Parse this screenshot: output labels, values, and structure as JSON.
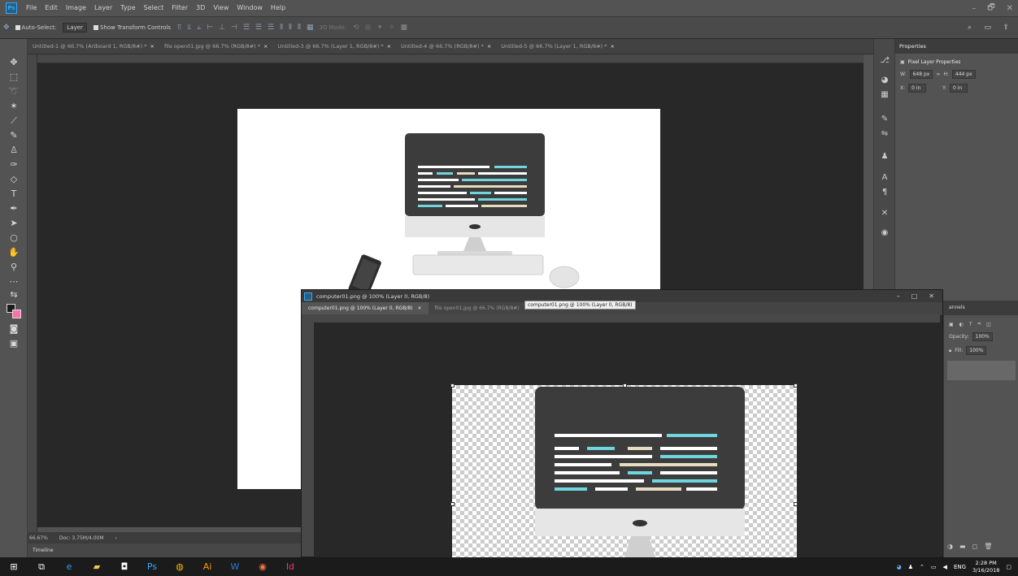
{
  "menubar": {
    "logo": "Ps",
    "items": [
      "File",
      "Edit",
      "Image",
      "Layer",
      "Type",
      "Select",
      "Filter",
      "3D",
      "View",
      "Window",
      "Help"
    ],
    "window_controls": [
      "–",
      "🗗",
      "✕"
    ]
  },
  "options": {
    "auto_select": "Auto-Select:",
    "auto_select_target": "Layer",
    "show_transform": "Show Transform Controls",
    "mode_label": "3D Mode:"
  },
  "doc_tabs": [
    "Untitled-1 @ 66.7% (Artboard 1, RGB/8#) *",
    "file open01.jpg @ 66.7% (RGB/8#) *",
    "Untitled-3 @ 66.7% (Layer 1, RGB/8#) *",
    "Untitled-4 @ 66.7% (RGB/8#) *",
    "Untitled-5 @ 66.7% (Layer 1, RGB/8#) *"
  ],
  "tab_close": "×",
  "status": {
    "zoom": "66.67%",
    "doc": "Doc: 3.75M/4.00M"
  },
  "timeline": "Timeline",
  "properties": {
    "title": "Properties",
    "section": "Pixel Layer Properties",
    "w_label": "W:",
    "w_value": "648 px",
    "h_label": "H:",
    "h_value": "444 px",
    "x_label": "X:",
    "x_value": "0 in",
    "y_label": "Y:",
    "y_value": "0 in"
  },
  "layers": {
    "title": "annels",
    "opacity_label": "Opacity:",
    "opacity_value": "100%",
    "fill_label": "Fill:",
    "fill_value": "100%"
  },
  "float": {
    "title": "computer01.png @ 100% (Layer 0, RGB/8)",
    "tab_active": "computer01.png @ 100% (Layer 0, RGB/8)",
    "tab_other": "file open01.jpg @ 66.7% (RGB/8#)",
    "tooltip": "computer01.png @ 100% (Layer 0, RGB/8)"
  },
  "taskbar": {
    "lang": "ENG",
    "time": "2:28 PM",
    "date": "3/16/2018"
  }
}
